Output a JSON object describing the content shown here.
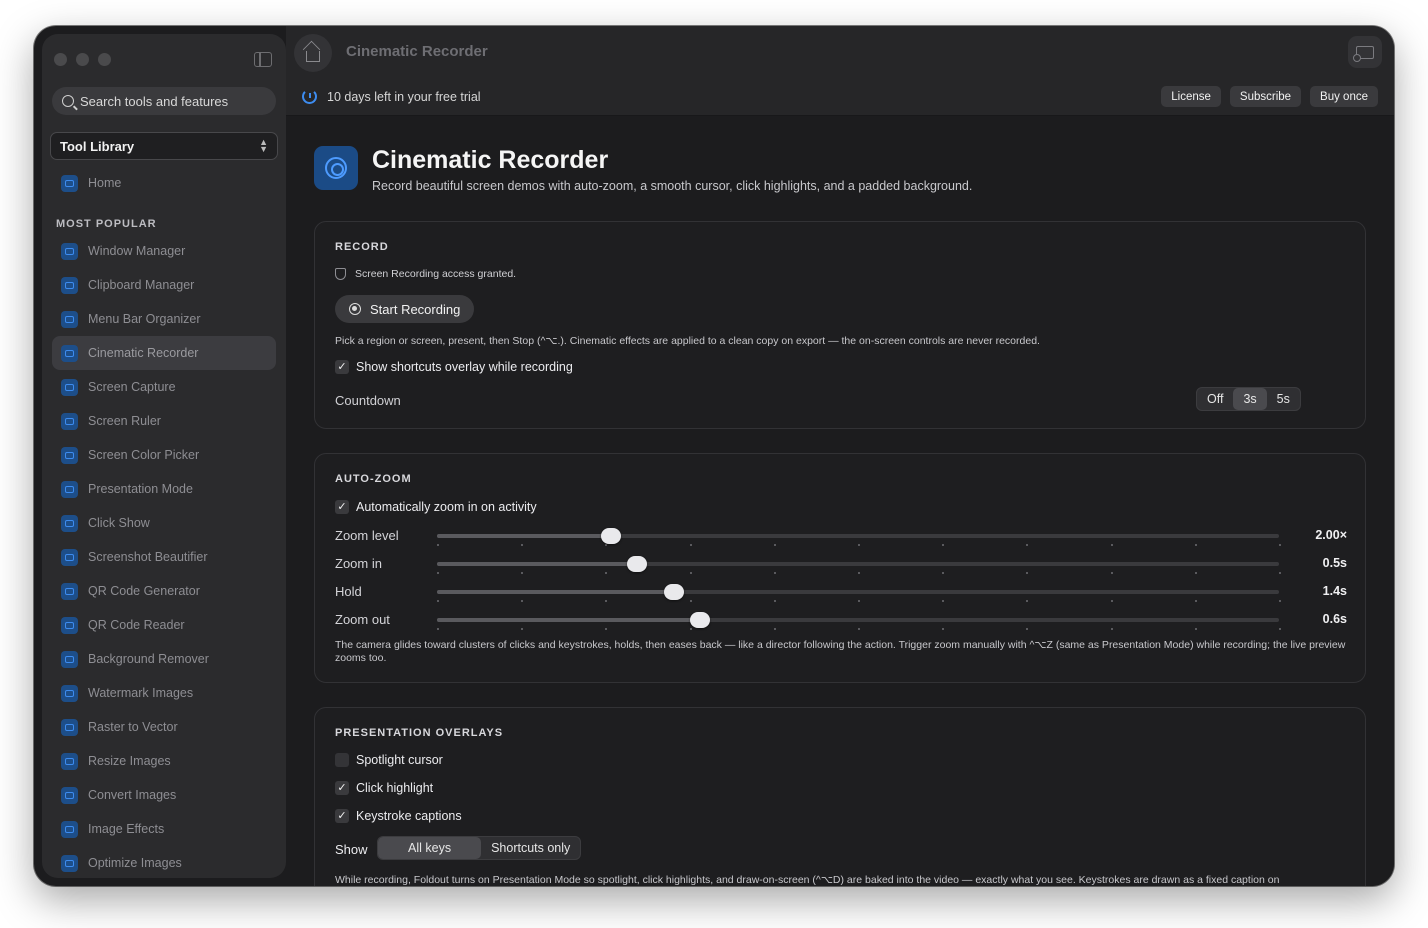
{
  "app": {
    "title": "Cinematic Recorder"
  },
  "sidebar": {
    "search_placeholder": "Search tools and features",
    "library_label": "Tool Library",
    "home_label": "Home",
    "section_title": "MOST POPULAR",
    "items": [
      {
        "label": "Window Manager"
      },
      {
        "label": "Clipboard Manager"
      },
      {
        "label": "Menu Bar Organizer"
      },
      {
        "label": "Cinematic Recorder",
        "active": true
      },
      {
        "label": "Screen Capture"
      },
      {
        "label": "Screen Ruler"
      },
      {
        "label": "Screen Color Picker"
      },
      {
        "label": "Presentation Mode"
      },
      {
        "label": "Click Show"
      },
      {
        "label": "Screenshot Beautifier"
      },
      {
        "label": "QR Code Generator"
      },
      {
        "label": "QR Code Reader"
      },
      {
        "label": "Background Remover"
      },
      {
        "label": "Watermark Images"
      },
      {
        "label": "Raster to Vector"
      },
      {
        "label": "Resize Images"
      },
      {
        "label": "Convert Images"
      },
      {
        "label": "Image Effects"
      },
      {
        "label": "Optimize Images"
      }
    ]
  },
  "trial": {
    "text": "10 days left in your free trial",
    "buttons": {
      "license": "License",
      "subscribe": "Subscribe",
      "buy": "Buy once"
    }
  },
  "hero": {
    "title": "Cinematic Recorder",
    "subtitle": "Record beautiful screen demos with auto-zoom, a smooth cursor, click highlights, and a padded background."
  },
  "record": {
    "title": "RECORD",
    "access_text": "Screen Recording access granted.",
    "start_label": "Start Recording",
    "hint": "Pick a region or screen, present, then Stop (^⌥.). Cinematic effects are applied to a clean copy on export — the on-screen controls are never recorded.",
    "shortcuts_overlay_label": "Show shortcuts overlay while recording",
    "shortcuts_overlay_checked": true,
    "countdown_label": "Countdown",
    "countdown_options": [
      "Off",
      "3s",
      "5s"
    ],
    "countdown_selected": "3s"
  },
  "autozoom": {
    "title": "AUTO-ZOOM",
    "auto_label": "Automatically zoom in on activity",
    "auto_checked": true,
    "sliders": [
      {
        "label": "Zoom level",
        "value_text": "2.00×",
        "fraction": 0.207
      },
      {
        "label": "Zoom in",
        "value_text": "0.5s",
        "fraction": 0.237
      },
      {
        "label": "Hold",
        "value_text": "1.4s",
        "fraction": 0.282
      },
      {
        "label": "Zoom out",
        "value_text": "0.6s",
        "fraction": 0.312
      }
    ],
    "description": "The camera glides toward clusters of clicks and keystrokes, holds, then eases back — like a director following the action. Trigger zoom manually with ^⌥Z (same as Presentation Mode) while recording; the live preview zooms too."
  },
  "overlays": {
    "title": "PRESENTATION OVERLAYS",
    "spotlight_label": "Spotlight cursor",
    "spotlight_checked": false,
    "click_label": "Click highlight",
    "click_checked": true,
    "keystroke_label": "Keystroke captions",
    "keystroke_checked": true,
    "show_label": "Show",
    "show_options": [
      "All keys",
      "Shortcuts only"
    ],
    "show_selected": "All keys",
    "description": "While recording, Foldout turns on Presentation Mode so spotlight, click highlights, and draw-on-screen (^⌥D) are baked into the video — exactly what you see. Keystrokes are drawn as a fixed caption on"
  }
}
